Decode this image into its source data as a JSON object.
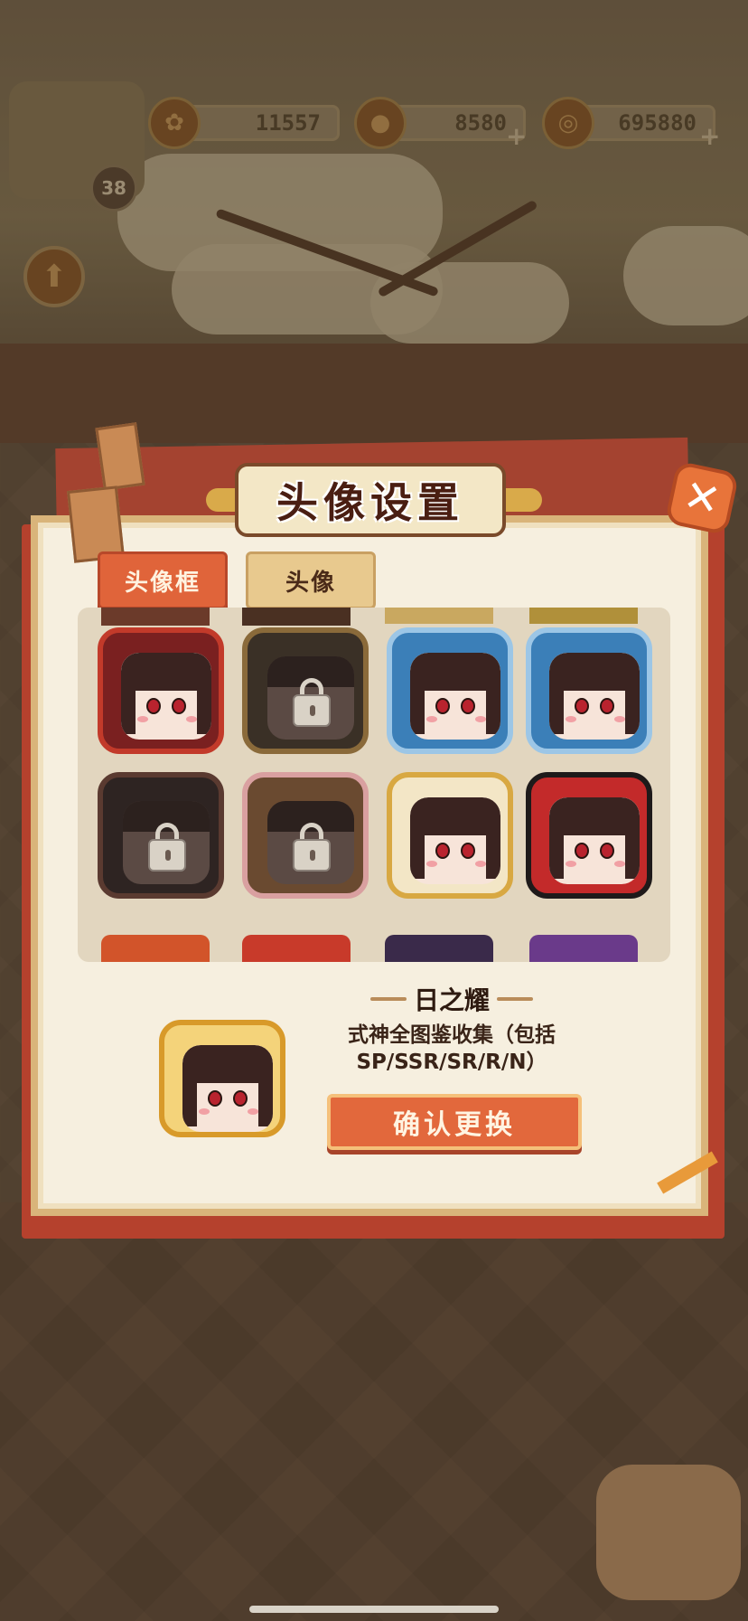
{
  "currency": {
    "jade": "11557",
    "stamina": "8580",
    "coins": "695880"
  },
  "player": {
    "level": "38"
  },
  "dialog": {
    "title": "头像设置",
    "tabs": [
      {
        "label": "头像框",
        "active": true
      },
      {
        "label": "头像",
        "active": false
      }
    ],
    "frames": [
      {
        "name": "torii-frame",
        "locked": false
      },
      {
        "name": "mask-frame",
        "locked": true
      },
      {
        "name": "wave-frame-1",
        "locked": false
      },
      {
        "name": "wave-frame-2",
        "locked": false
      },
      {
        "name": "dark-bun-frame",
        "locked": true
      },
      {
        "name": "bonsai-frame",
        "locked": true
      },
      {
        "name": "gold-card-frame",
        "locked": false
      },
      {
        "name": "bear-frame",
        "locked": false
      }
    ],
    "selected": {
      "name": "日之耀",
      "description": "式神全图鉴收集（包括SP/SSR/SR/R/N）"
    },
    "confirm_label": "确认更换"
  },
  "colors": {
    "accent_orange": "#e2683c",
    "dialog_red": "#b5412d",
    "paper": "#f6efdf"
  }
}
